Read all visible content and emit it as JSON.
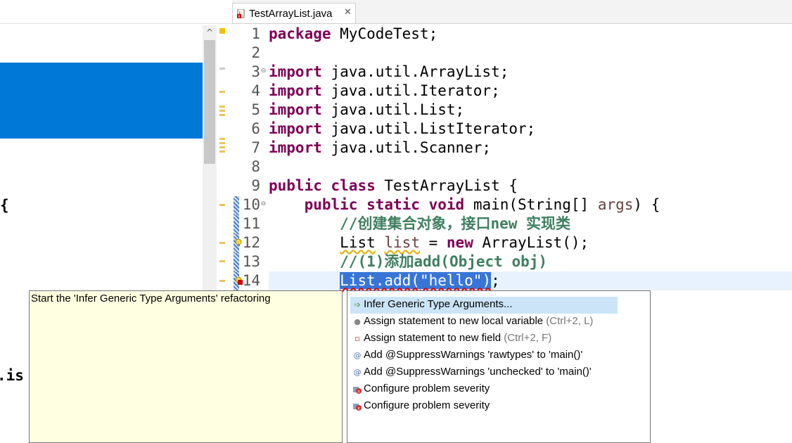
{
  "editor": {
    "tab_label": "TestArrayList.java",
    "tab_close": "✕"
  },
  "left_pane": {
    "code_fragments": [
      "{",
      ".is"
    ],
    "scroll_up": "^"
  },
  "code": {
    "line_numbers": [
      "1",
      "2",
      "3",
      "4",
      "5",
      "6",
      "7",
      "8",
      "9",
      "10",
      "11",
      "12",
      "13",
      "14"
    ],
    "l1_kw": "package",
    "l1_rest": " MyCodeTest;",
    "l3_kw": "import",
    "l3_rest": " java.util.ArrayList;",
    "l4_kw": "import",
    "l4_rest": " java.util.Iterator;",
    "l5_kw": "import",
    "l5_rest": " java.util.List;",
    "l6_kw": "import",
    "l6_rest": " java.util.ListIterator;",
    "l7_kw": "import",
    "l7_rest": " java.util.Scanner;",
    "l9_kw1": "public",
    "l9_kw2": "class",
    "l9_rest": " TestArrayList {",
    "l10_indent": "    ",
    "l10_kw1": "public",
    "l10_kw2": "static",
    "l10_kw3": "void",
    "l10_mid": " main(String[] ",
    "l10_var": "args",
    "l10_end": ") {",
    "l11_indent": "        ",
    "l11_comment": "//创建集合对象，接口new 实现类",
    "l12_indent": "        ",
    "l12_type": "List",
    "l12_sp": " ",
    "l12_var": "list",
    "l12_mid": " = ",
    "l12_kw": "new",
    "l12_end": " ArrayList();",
    "l13_indent": "        ",
    "l13_comment": "//(1)添加add(Object obj)",
    "l14_indent": "        ",
    "l14_sel_a": "List.add(",
    "l14_str": "\"hello\"",
    "l14_sel_b": ")",
    "l14_end": ";"
  },
  "hover_info": {
    "text": "Start the 'Infer Generic Type Arguments' refactoring"
  },
  "proposals": [
    {
      "label": "Infer Generic Type Arguments...",
      "shortcut": "",
      "icon": "refactor-arrow-icon"
    },
    {
      "label": "Assign statement to new local variable",
      "shortcut": " (Ctrl+2, L)",
      "icon": "local-variable-icon"
    },
    {
      "label": "Assign statement to new field",
      "shortcut": " (Ctrl+2, F)",
      "icon": "field-icon"
    },
    {
      "label": "Add @SuppressWarnings 'rawtypes' to 'main()'",
      "shortcut": "",
      "icon": "annotation-icon"
    },
    {
      "label": "Add @SuppressWarnings 'unchecked' to 'main()'",
      "shortcut": "",
      "icon": "annotation-icon"
    },
    {
      "label": "Configure problem severity",
      "shortcut": "",
      "icon": "configure-severity-icon"
    },
    {
      "label": "Configure problem severity",
      "shortcut": "",
      "icon": "configure-severity-icon"
    }
  ],
  "icon_glyphs": {
    "annotation": "@",
    "local_variable": "●",
    "field": "▫",
    "refactor": "➩",
    "fold": "⊖"
  }
}
